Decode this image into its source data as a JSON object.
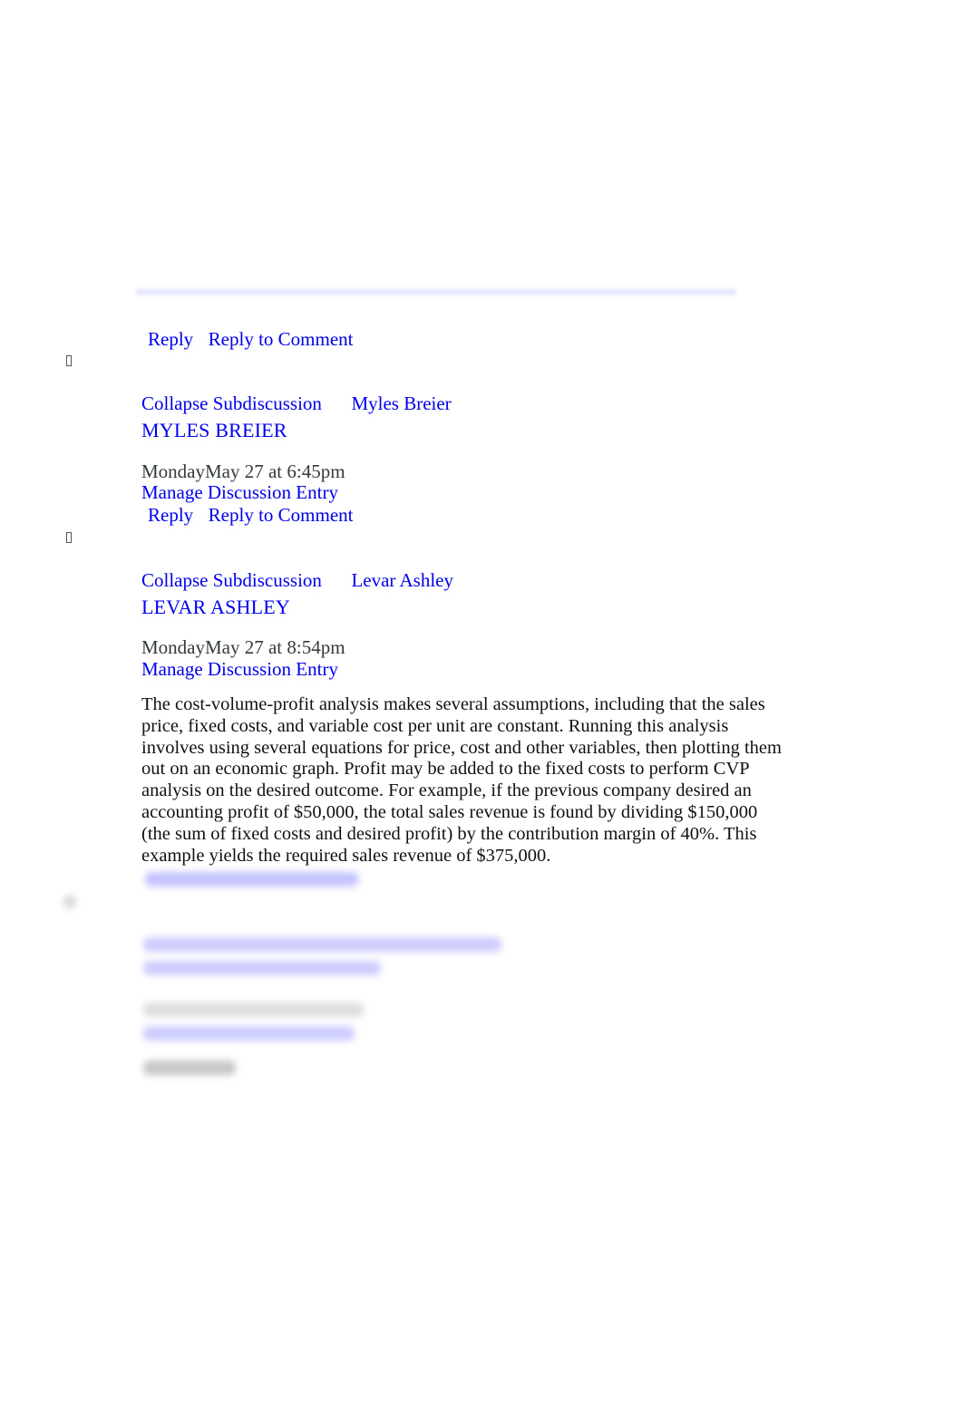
{
  "colors": {
    "link": "#0000ee",
    "timestamp": "#333a3f",
    "body_text": "#111111"
  },
  "top_entry": {
    "reply_label": "Reply",
    "reply_to_comment_label": "Reply to Comment"
  },
  "entries": [
    {
      "collapse_label": "Collapse Subdiscussion",
      "author_link": "Myles Breier",
      "author_heading": "MYLES BREIER",
      "timestamp": "MondayMay 27 at 6:45pm",
      "manage_label": "Manage Discussion Entry",
      "reply_label": "Reply",
      "reply_to_comment_label": "Reply to Comment",
      "toggle_icon": "expand-toggle-icon"
    },
    {
      "collapse_label": "Collapse Subdiscussion",
      "author_link": "Levar Ashley",
      "author_heading": "LEVAR ASHLEY",
      "timestamp": "MondayMay 27 at 8:54pm",
      "manage_label": "Manage Discussion Entry",
      "body": "The cost-volume-profit analysis makes several assumptions, including that the sales price, fixed costs, and variable cost per unit are constant. Running this analysis involves using several equations for price, cost and other variables, then plotting them out on an economic graph. Profit may be added to the fixed costs to perform CVP analysis on the desired outcome. For example, if the previous company desired an accounting profit of $50,000, the total sales revenue is found by dividing $150,000 (the sum of fixed costs and desired profit) by the contribution margin of 40%. This example yields the required sales revenue of $375,000.",
      "toggle_icon": "expand-toggle-icon"
    }
  ]
}
